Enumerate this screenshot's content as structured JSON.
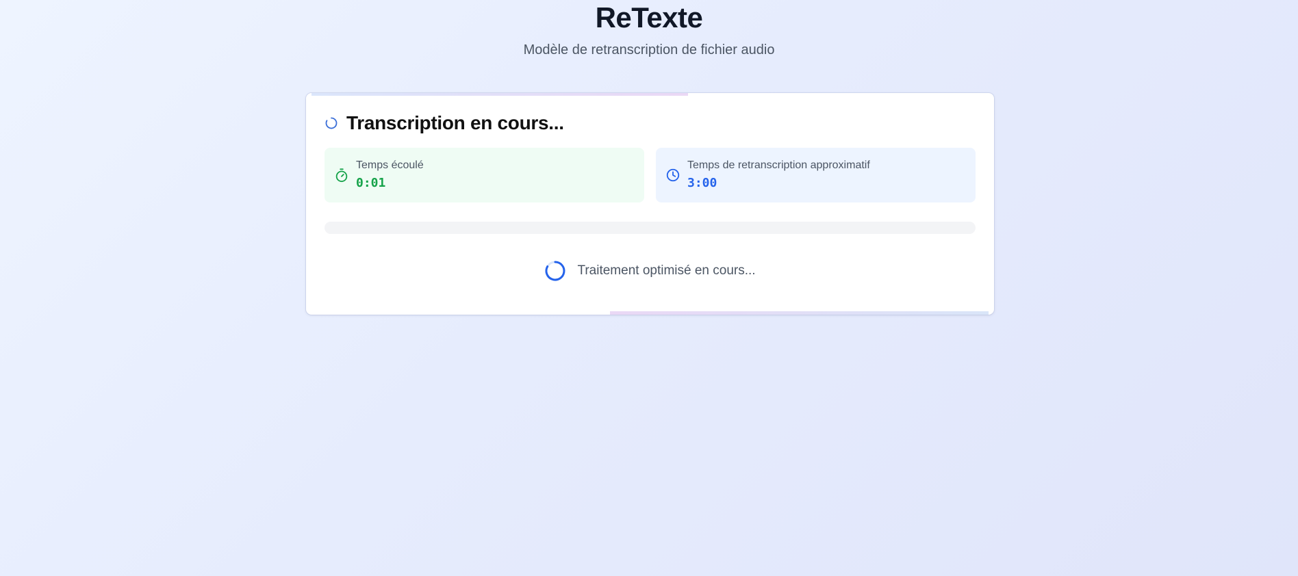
{
  "app": {
    "title": "ReTexte",
    "subtitle": "Modèle de retranscription de fichier audio"
  },
  "card": {
    "title": "Transcription en cours...",
    "status_icon": "spinner-icon",
    "elapsed": {
      "label": "Temps écoulé",
      "value": "0:01",
      "icon": "stopwatch-icon"
    },
    "estimate": {
      "label": "Temps de retranscription approximatif",
      "value": "3:00",
      "icon": "clock-icon"
    },
    "progress": {
      "fraction": 0.0
    },
    "processing": {
      "text": "Traitement optimisé en cours...",
      "icon": "spinner-icon"
    }
  },
  "colors": {
    "elapsed_accent": "#16a34a",
    "estimate_accent": "#2563eb",
    "spinner": "#2563eb"
  }
}
